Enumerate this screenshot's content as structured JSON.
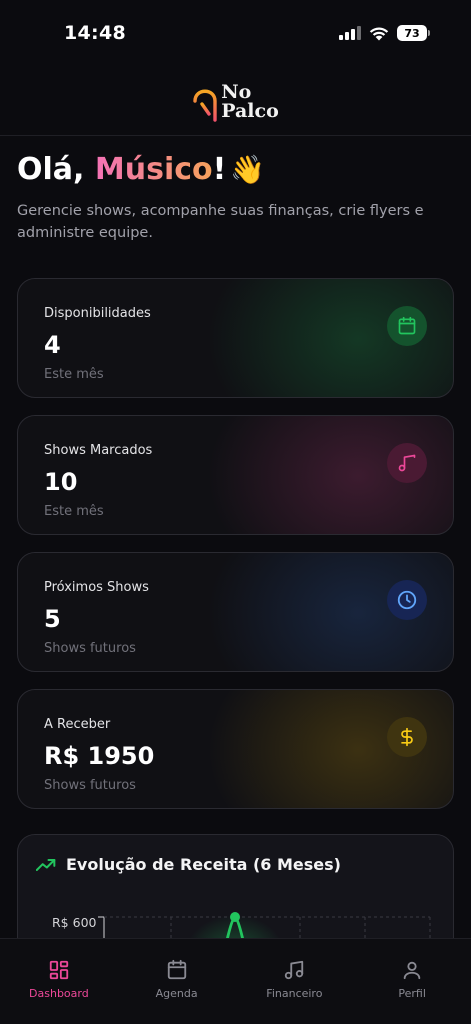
{
  "status_bar": {
    "time": "14:48",
    "battery": "73"
  },
  "header": {
    "logo_line1": "No",
    "logo_line2": "Palco"
  },
  "greeting": {
    "prefix": "Olá, ",
    "name": "Músico",
    "suffix": "!",
    "emoji": "👋"
  },
  "subtitle": "Gerencie shows, acompanhe suas finanças, crie flyers e administre equipe.",
  "cards": [
    {
      "label": "Disponibilidades",
      "value": "4",
      "note": "Este mês",
      "icon": "calendar-icon",
      "color": "#22c55e"
    },
    {
      "label": "Shows Marcados",
      "value": "10",
      "note": "Este mês",
      "icon": "music-note-icon",
      "color": "#ec4899"
    },
    {
      "label": "Próximos Shows",
      "value": "5",
      "note": "Shows futuros",
      "icon": "clock-icon",
      "color": "#3b82f6"
    },
    {
      "label": "A Receber",
      "value": "R$ 1950",
      "note": "Shows futuros",
      "icon": "dollar-icon",
      "color": "#eab308"
    }
  ],
  "revenue_chart": {
    "title": "Evolução de Receita (6 Meses)",
    "icon": "trending-up-icon",
    "y_tick_top": "R$ 600",
    "line_color": "#22c55e"
  },
  "bottom_nav": [
    {
      "label": "Dashboard",
      "icon": "dashboard-icon",
      "active": true
    },
    {
      "label": "Agenda",
      "icon": "calendar-icon",
      "active": false
    },
    {
      "label": "Financeiro",
      "icon": "music-icon",
      "active": false
    },
    {
      "label": "Perfil",
      "icon": "user-icon",
      "active": false
    }
  ],
  "colors": {
    "accent": "#ec4899",
    "background": "#0b0b0f"
  }
}
